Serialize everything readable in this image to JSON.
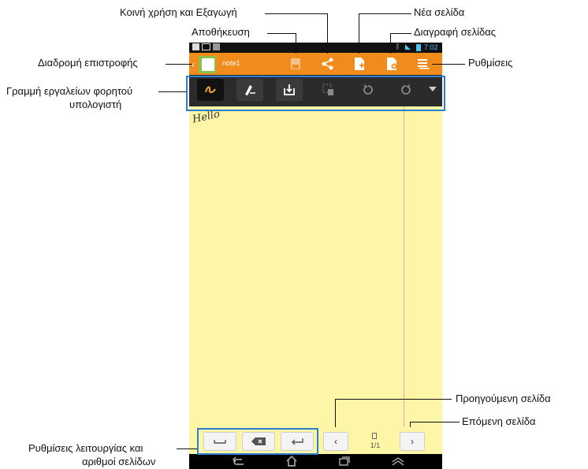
{
  "status": {
    "time": "7:02"
  },
  "app": {
    "note_name": "note1"
  },
  "note": {
    "text": "Hello"
  },
  "pager": {
    "page": "1/1"
  },
  "labels": {
    "share_export": "Κοινή χρήση και Εξαγωγή",
    "save": "Αποθήκευση",
    "new_page": "Νέα σελίδα",
    "delete_page": "Διαγραφή σελίδας",
    "back": "Διαδρομή επιστροφής",
    "settings": "Ρυθμίσεις",
    "toolbar_line1": "Γραμμή εργαλείων φορητού",
    "toolbar_line2": "υπολογιστή",
    "prev_page": "Προηγούμενη σελίδα",
    "next_page": "Επόμενη σελίδα",
    "mode_line1": "Ρυθμίσεις λειτουργίας και",
    "mode_line2": "αριθμοί σελίδων"
  },
  "colors": {
    "actionbar": "#f08c1c",
    "page": "#fdf6a6",
    "toolbar": "#2b2b2b",
    "highlight": "#2a7fd0"
  }
}
